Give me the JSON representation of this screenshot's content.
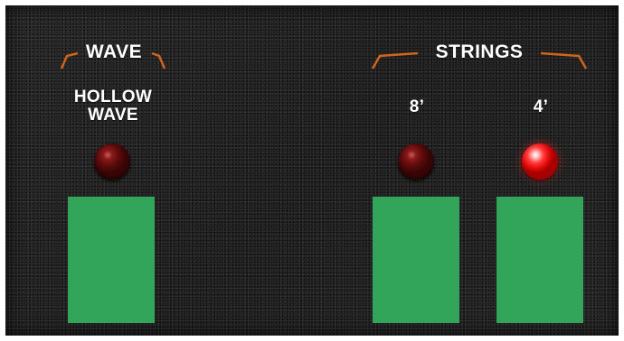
{
  "sections": {
    "wave": {
      "title": "WAVE",
      "switches": [
        {
          "label": "HOLLOW WAVE",
          "label_lines": [
            "HOLLOW",
            "WAVE"
          ],
          "led_on": false
        }
      ]
    },
    "strings": {
      "title": "STRINGS",
      "switches": [
        {
          "label": "8’",
          "led_on": false
        },
        {
          "label": "4’",
          "led_on": true
        }
      ]
    }
  },
  "colors": {
    "panel": "#1e1e1e",
    "bracket": "#d0641e",
    "switch": "#33a55a",
    "led_off": "#5e0b0b",
    "led_on": "#e10b0b",
    "text": "#ffffff"
  },
  "icons": {
    "led": "led-indicator-icon",
    "bracket": "bracket-line-icon"
  }
}
